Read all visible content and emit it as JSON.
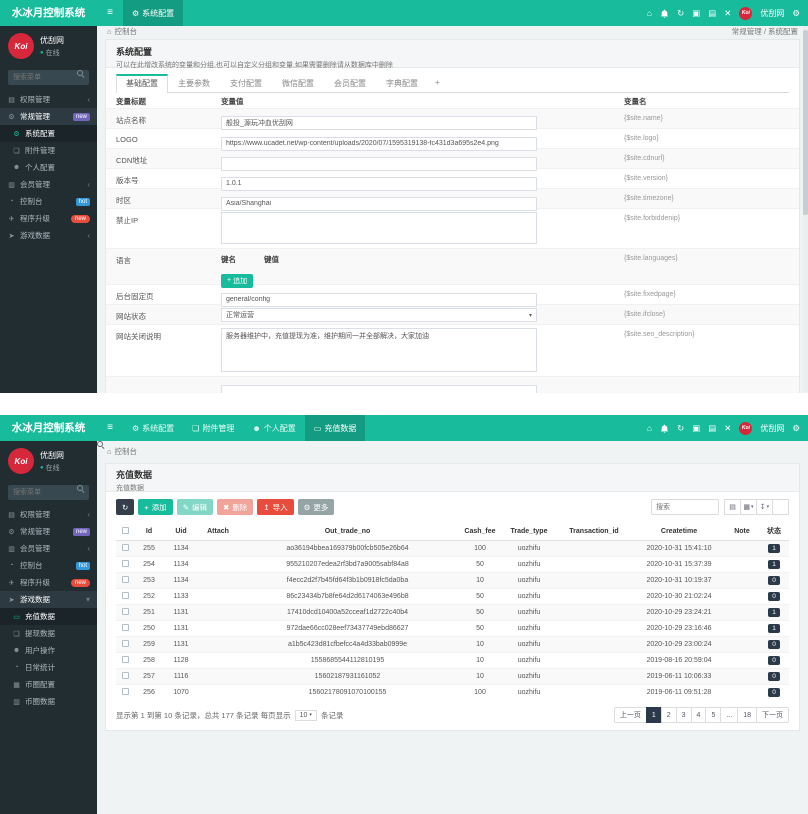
{
  "brand": "水冰月控制系统",
  "user": {
    "name": "优刮网",
    "status": "在线",
    "avatar": "Koi"
  },
  "sidebarSearch": "搜索菜单",
  "colors": {
    "accent": "#18bc9c",
    "danger": "#e74c3c",
    "badge_new_purple": "#7266ba",
    "badge_hot_blue": "#3498db",
    "dark_navy": "#2b3a48"
  },
  "icons": {
    "hamburger": "≡",
    "home": "⌂",
    "refresh": "↻",
    "box": "▣",
    "grid": "▤",
    "fullscreen": "✕",
    "gear": "⚙",
    "file": "❏",
    "user": "☻",
    "card": "▭",
    "users": "▤",
    "members": "▥",
    "dashboard": "◔",
    "plane": "✈",
    "rocket": "➤",
    "clock": "◔",
    "table": "▦",
    "chart": "▥",
    "chev_left": "‹",
    "chev_down": "▾",
    "caret": "▾",
    "plus": "+",
    "pencil": "✎",
    "trash": "✖",
    "upload": "↥",
    "list": "▤",
    "columns": "▦",
    "export": "↧",
    "dot": "●"
  },
  "s1": {
    "navTab": "系统配置",
    "crumbLeft": "控制台",
    "crumbRight": "常规管理 / 系统配置",
    "menu": [
      {
        "label": "权限管理"
      },
      {
        "label": "常规管理",
        "badge": "new"
      },
      {
        "label": "系统配置"
      },
      {
        "label": "附件管理"
      },
      {
        "label": "个人配置"
      },
      {
        "label": "会员管理"
      },
      {
        "label": "控制台",
        "badge": "hot"
      },
      {
        "label": "程序升级",
        "badge": "new"
      },
      {
        "label": "游戏数据"
      }
    ],
    "panelTitle": "系统配置",
    "panelDesc": "可以在此增改系统的变量和分组,也可以自定义分组和变量,如果需要删除请从数据库中删除",
    "tabs": [
      "基础配置",
      "主要参数",
      "支付配置",
      "微信配置",
      "会员配置",
      "字典配置",
      "+"
    ],
    "formHead": [
      "变量标题",
      "变量值",
      "变量名"
    ],
    "rows": [
      {
        "t": "站点名称",
        "v": "般投_源玩冲血优刮网",
        "n": "{$site.name}"
      },
      {
        "t": "LOGO",
        "v": "https://www.ucadet.net/wp-content/uploads/2020/07/1595319138-fc431d3a695s2e4.png",
        "n": "{$site.logo}"
      },
      {
        "t": "CDN地址",
        "v": "",
        "n": "{$site.cdnurl}"
      },
      {
        "t": "版本号",
        "v": "1.0.1",
        "n": "{$site.version}"
      },
      {
        "t": "时区",
        "v": "Asia/Shanghai",
        "n": "{$site.timezone}"
      },
      {
        "t": "禁止IP",
        "v": "",
        "n": "{$site.forbiddenip}"
      },
      {
        "t": "语言",
        "k": "键名",
        "kv": "键值",
        "add": "追加",
        "n": "{$site.languages}"
      },
      {
        "t": "后台固定页",
        "v": "general/config",
        "n": "{$site.fixedpage}"
      },
      {
        "t": "网站状态",
        "v": "正常运营",
        "n": "{$site.ifclose}"
      },
      {
        "t": "网站关闭说明",
        "v": "服务器维护中，充值提现为准，维护期间一并全部解决，大家加油",
        "n": "{$site.seo_description}"
      }
    ]
  },
  "s2": {
    "navTabs": [
      "系统配置",
      "附件管理",
      "个人配置",
      "充值数据"
    ],
    "crumbLeft": "控制台",
    "menu": [
      {
        "label": "权限管理"
      },
      {
        "label": "常规管理",
        "badge": "new"
      },
      {
        "label": "会员管理"
      },
      {
        "label": "控制台",
        "badge": "hot"
      },
      {
        "label": "程序升级",
        "badge": "new"
      },
      {
        "label": "游戏数据"
      },
      {
        "label": "充值数据"
      },
      {
        "label": "提现数据"
      },
      {
        "label": "用户操作"
      },
      {
        "label": "日常统计"
      },
      {
        "label": "币圈配置"
      },
      {
        "label": "币圈数据"
      }
    ],
    "panelTitle": "充值数据",
    "panelDesc": "充值数据",
    "toolbar": {
      "add": "添加",
      "edit": "编辑",
      "del": "删除",
      "import": "导入",
      "more": "更多",
      "searchPh": "搜索"
    },
    "cols": [
      "Id",
      "Uid",
      "Attach",
      "Out_trade_no",
      "Cash_fee",
      "Trade_type",
      "Transaction_id",
      "Createtime",
      "Note",
      "状态"
    ],
    "rows": [
      [
        "255",
        "1134",
        "",
        "ao36194bbea169379b00fcb505e26b64",
        "100",
        "uozhifu",
        "",
        "2020-10-31 15:41:10",
        "",
        "1"
      ],
      [
        "254",
        "1134",
        "",
        "955210207edea2rf3bd7a9005sabf84a8",
        "50",
        "uozhifu",
        "",
        "2020-10-31 15:37:39",
        "",
        "1"
      ],
      [
        "253",
        "1134",
        "",
        "f4ecc2d2f7b45fd64f3b1b0918fc5da0ba",
        "10",
        "uozhifu",
        "",
        "2020-10-31 10:19:37",
        "",
        "0"
      ],
      [
        "252",
        "1133",
        "",
        "86c23434b7b8fe64d2d6174063e496b8",
        "50",
        "uozhifu",
        "",
        "2020-10-30 21:02:24",
        "",
        "0"
      ],
      [
        "251",
        "1131",
        "",
        "17410dcd10400a52cceaf1d2722c40b4",
        "50",
        "uozhifu",
        "",
        "2020-10-29 23:24:21",
        "",
        "1"
      ],
      [
        "250",
        "1131",
        "",
        "972dae66cc028eef73437749ebd86627",
        "50",
        "uozhifu",
        "",
        "2020-10-29 23:16:46",
        "",
        "1"
      ],
      [
        "259",
        "1131",
        "",
        "a1b5c423d81cfbefcc4a4d33bab0999e",
        "10",
        "uozhifu",
        "",
        "2020-10-29 23:00:24",
        "",
        "0"
      ],
      [
        "258",
        "1128",
        "",
        "1558685544112810195",
        "10",
        "uozhifu",
        "",
        "2019-08-16 20:59:04",
        "",
        "0"
      ],
      [
        "257",
        "1116",
        "",
        "15602187931161052",
        "10",
        "uozhifu",
        "",
        "2019-06-11 10:06:33",
        "",
        "0"
      ],
      [
        "256",
        "1070",
        "",
        "15602178091070100155",
        "100",
        "uozhifu",
        "",
        "2019-06-11 09:51:28",
        "",
        "0"
      ]
    ],
    "footer": {
      "info": "显示第 1 到第 10 条记录，总共 177 条记录 每页显示",
      "per": "10",
      "suffix": "条记录",
      "pages": [
        "上一页",
        "1",
        "2",
        "3",
        "4",
        "5",
        "...",
        "18",
        "下一页"
      ]
    }
  }
}
